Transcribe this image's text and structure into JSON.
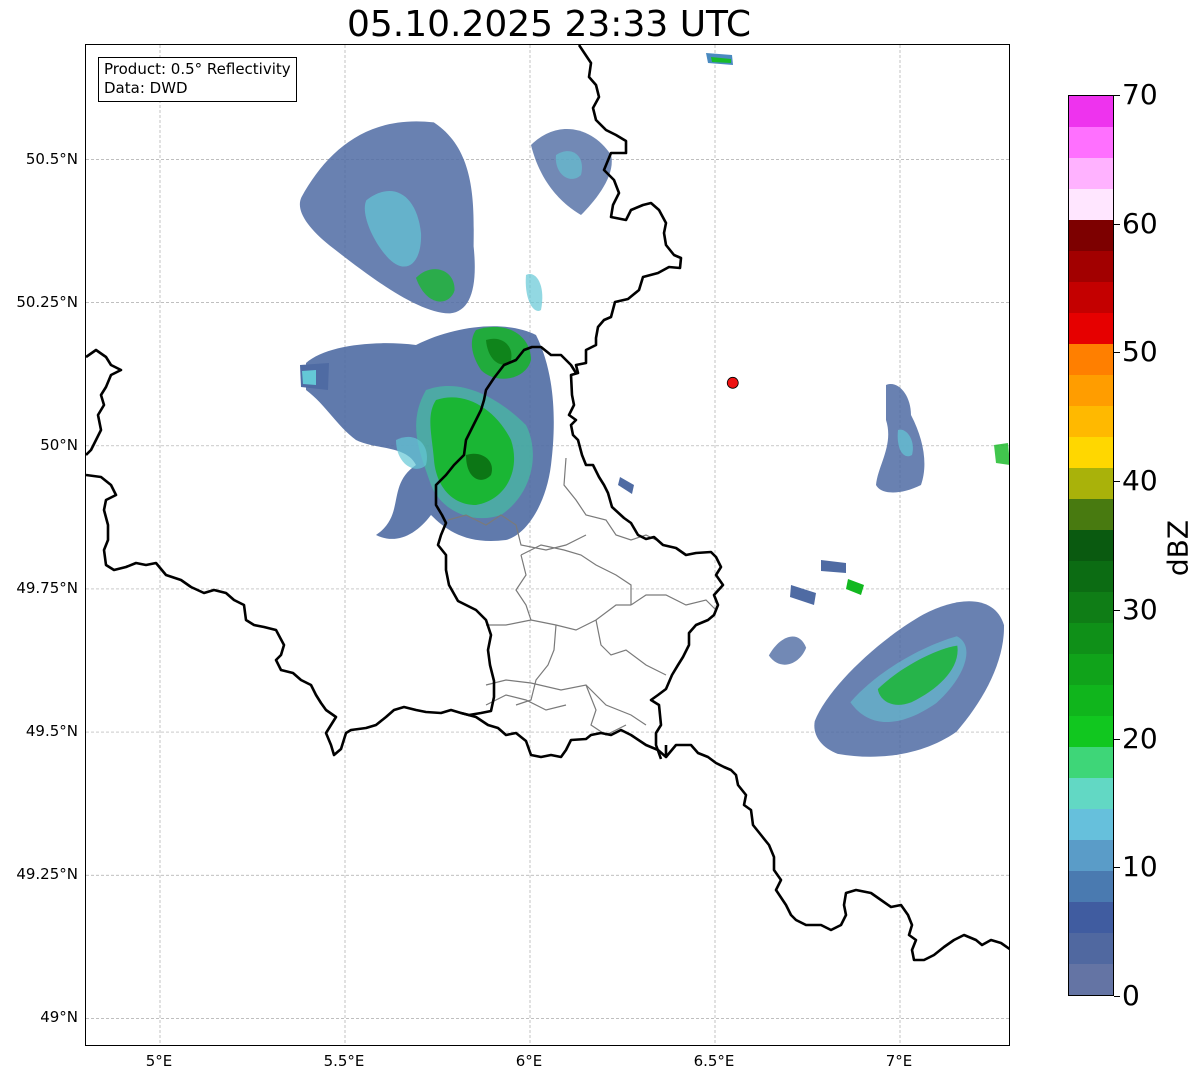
{
  "title": "05.10.2025 23:33 UTC",
  "info_box": {
    "product": "Product: 0.5° Reflectivity",
    "data": "Data: DWD"
  },
  "map": {
    "extent": {
      "lon": [
        4.8,
        7.3
      ],
      "lat": [
        48.95,
        50.7
      ]
    },
    "lat_ticks": [
      {
        "value": 50.5,
        "label": "50.5°N"
      },
      {
        "value": 50.25,
        "label": "50.25°N"
      },
      {
        "value": 50.0,
        "label": "50°N"
      },
      {
        "value": 49.75,
        "label": "49.75°N"
      },
      {
        "value": 49.5,
        "label": "49.5°N"
      },
      {
        "value": 49.25,
        "label": "49.25°N"
      },
      {
        "value": 49.0,
        "label": "49°N"
      }
    ],
    "lon_ticks": [
      {
        "value": 5.0,
        "label": "5°E"
      },
      {
        "value": 5.5,
        "label": "5.5°E"
      },
      {
        "value": 6.0,
        "label": "6°E"
      },
      {
        "value": 6.5,
        "label": "6.5°E"
      },
      {
        "value": 7.0,
        "label": "7°E"
      }
    ],
    "gridlines": true,
    "radar_site": {
      "lon": 6.548,
      "lat": 50.11,
      "color": "#ee1111"
    }
  },
  "colorbar": {
    "label": "dBZ",
    "min": 0,
    "max": 70,
    "step": 2.5,
    "ticks": [
      {
        "value": 0,
        "label": "0"
      },
      {
        "value": 10,
        "label": "10"
      },
      {
        "value": 20,
        "label": "20"
      },
      {
        "value": 30,
        "label": "30"
      },
      {
        "value": 40,
        "label": "40"
      },
      {
        "value": 50,
        "label": "50"
      },
      {
        "value": 60,
        "label": "60"
      },
      {
        "value": 70,
        "label": "70"
      }
    ],
    "colors": [
      "#6474a4",
      "#5068a0",
      "#405ca0",
      "#4a7ab0",
      "#5a9cc8",
      "#66c0dc",
      "#62d8c4",
      "#3ed678",
      "#11c71f",
      "#10b51c",
      "#10a31a",
      "#0f9018",
      "#0f7d16",
      "#0c6c13",
      "#0a5a10",
      "#487a10",
      "#a9b20a",
      "#ffd700",
      "#ffb900",
      "#ff9d00",
      "#ff7f00",
      "#e60000",
      "#c40000",
      "#a20000",
      "#7d0000",
      "#ffe6ff",
      "#ffb2ff",
      "#ff70ff",
      "#ee33ee"
    ]
  }
}
